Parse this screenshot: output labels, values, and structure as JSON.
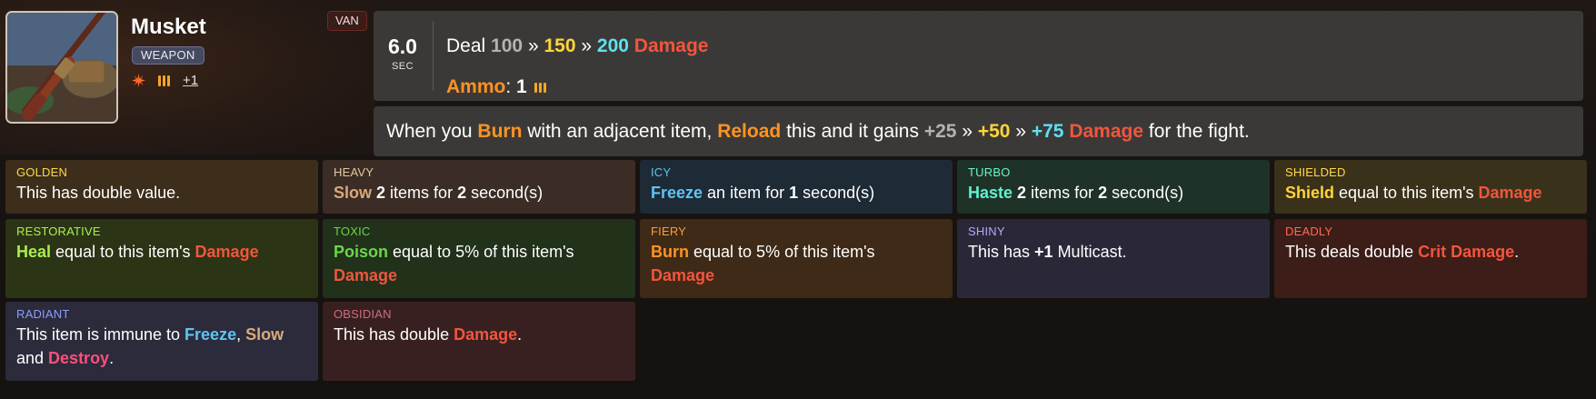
{
  "item": {
    "name": "Musket",
    "type_tag": "WEAPON",
    "hero_tag": "VAN",
    "multicast_icon_text": "+1",
    "image_icon": "musket-image"
  },
  "stats": {
    "cooldown_value": "6.0",
    "cooldown_unit": "SEC",
    "deal_label": "Deal",
    "damage_tiers": [
      "100",
      "150",
      "200"
    ],
    "tier_separator": "»",
    "damage_word": "Damage",
    "ammo_label": "Ammo",
    "ammo_colon": ":",
    "ammo_value": "1"
  },
  "effect": {
    "p1": "When you",
    "kw_burn": "Burn",
    "p2": "with an adjacent item,",
    "kw_reload": "Reload",
    "p3": "this and it gains",
    "tiers": [
      "+25",
      "+50",
      "+75"
    ],
    "sep": "»",
    "kw_damage": "Damage",
    "p4": "for the fight."
  },
  "enchantments": [
    {
      "name": "GOLDEN",
      "parts": [
        "This has double value."
      ]
    },
    {
      "name": "HEAVY",
      "parts": [
        "Slow",
        " ",
        "2",
        " items for ",
        "2",
        " second(s)"
      ]
    },
    {
      "name": "ICY",
      "parts": [
        "Freeze",
        " an item for ",
        "1",
        " second(s)"
      ]
    },
    {
      "name": "TURBO",
      "parts": [
        "Haste",
        " ",
        "2",
        " items for ",
        "2",
        " second(s)"
      ]
    },
    {
      "name": "SHIELDED",
      "parts": [
        "Shield",
        " equal to this item's ",
        "Damage"
      ]
    },
    {
      "name": "RESTORATIVE",
      "parts": [
        "Heal",
        " equal to this item's ",
        "Damage"
      ]
    },
    {
      "name": "TOXIC",
      "parts": [
        "Poison",
        " equal to 5% of this item's ",
        "Damage"
      ]
    },
    {
      "name": "FIERY",
      "parts": [
        "Burn",
        " equal to 5% of this item's ",
        "Damage"
      ]
    },
    {
      "name": "SHINY",
      "parts": [
        "This has ",
        "+1",
        " Multicast."
      ]
    },
    {
      "name": "DEADLY",
      "parts": [
        "This deals double ",
        "Crit Damage",
        "."
      ]
    },
    {
      "name": "RADIANT",
      "parts": [
        "This item is immune to ",
        "Freeze",
        ", ",
        "Slow",
        " and ",
        "Destroy",
        "."
      ]
    },
    {
      "name": "OBSIDIAN",
      "parts": [
        "This has double ",
        "Damage",
        "."
      ]
    }
  ],
  "colors": {
    "damage": "#f2553d",
    "burn": "#ff9322",
    "tier_bronze": "#b3b3b3",
    "tier_gold": "#ffd43b",
    "tier_diamond": "#5ee0f2"
  }
}
